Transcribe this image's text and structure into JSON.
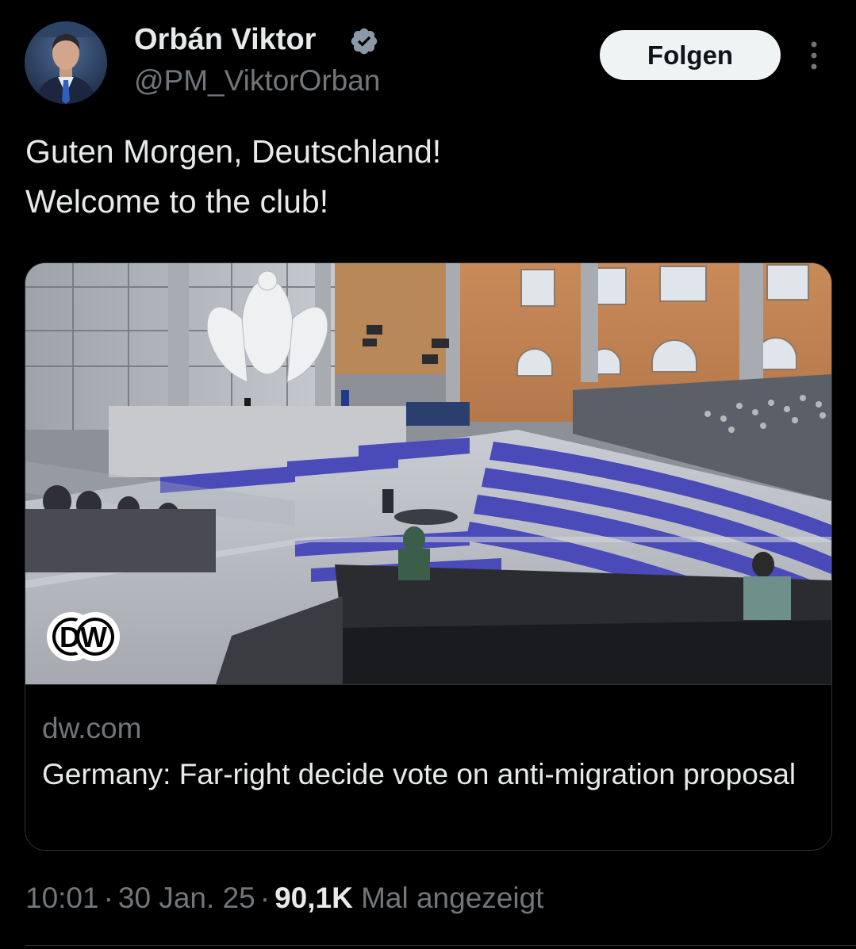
{
  "author": {
    "display_name": "Orbán Viktor",
    "handle": "@PM_ViktorOrban",
    "verified": true,
    "avatar_icon": "profile-photo"
  },
  "actions": {
    "follow_label": "Folgen",
    "more_icon": "more-vertical-icon"
  },
  "tweet": {
    "lines": [
      "Guten Morgen, Deutschland!",
      "Welcome to the club!"
    ]
  },
  "card": {
    "image_badge": "DW",
    "domain": "dw.com",
    "title": "Germany: Far-right decide vote on anti-migration proposal"
  },
  "meta": {
    "time": "10:01",
    "separator": "·",
    "date": "30 Jan. 25",
    "views_count": "90,1K",
    "views_label": "Mal angezeigt"
  },
  "colors": {
    "background": "#000000",
    "text_primary": "#e7e9ea",
    "text_secondary": "#71767b",
    "verified_blue": "#1d9bf0",
    "follow_button_bg": "#eff3f4",
    "border": "#2f3336"
  }
}
